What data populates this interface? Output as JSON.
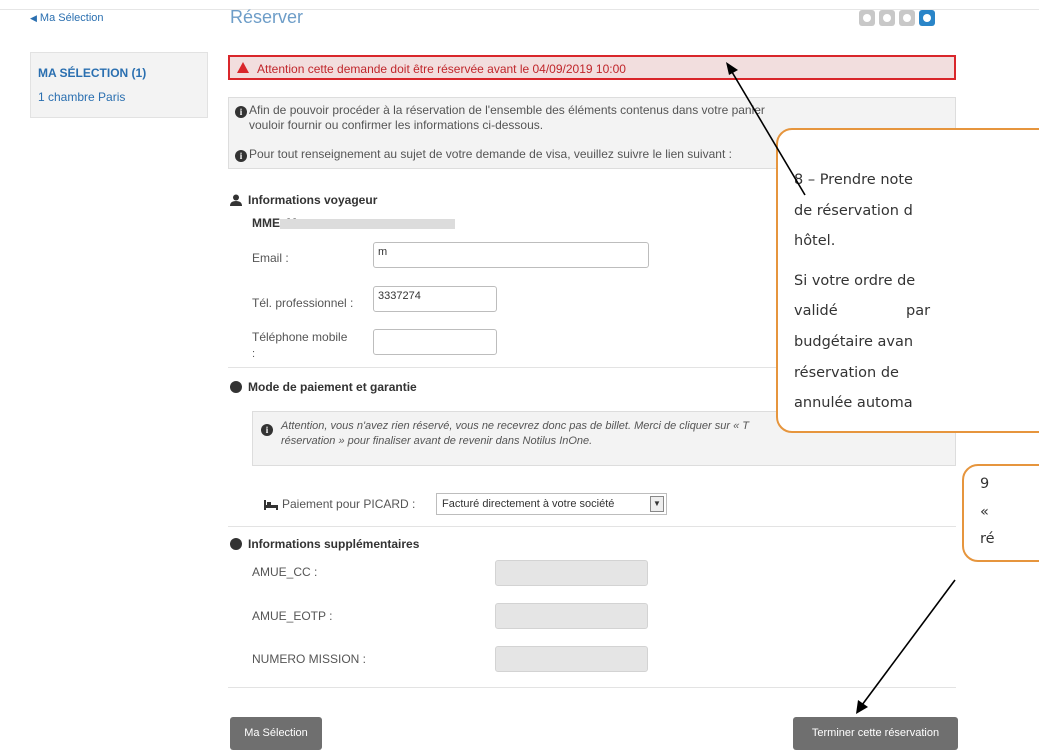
{
  "nav": {
    "back_label": "Ma Sélection"
  },
  "header": {
    "title": "Réserver"
  },
  "steps": {
    "count": 4,
    "active_index": 3
  },
  "sidebar": {
    "title": "MA SÉLECTION (1)",
    "item": "1 chambre Paris"
  },
  "alert": {
    "text": "Attention cette demande doit être réservée avant le 04/09/2019 10:00"
  },
  "info": {
    "line1": "Afin de pouvoir procéder à la réservation de l'ensemble des éléments contenus dans votre panier",
    "line2": "vouloir fournir ou confirmer les informations ci-dessous.",
    "line3": "Pour tout renseignement au sujet de votre demande de visa, veuillez suivre le lien suivant :"
  },
  "traveler": {
    "heading": "Informations voyageur",
    "name": "MME. M",
    "email_label": "Email :",
    "email_value": "m",
    "work_phone_label": "Tél. professionnel :",
    "work_phone_value": "3337274",
    "mobile_label": "Téléphone mobile",
    "mobile_label_suffix": ":",
    "mobile_value": ""
  },
  "payment": {
    "heading": "Mode de paiement et garantie",
    "notice_line1": "Attention, vous n'avez rien réservé, vous ne recevrez donc pas de billet. Merci de cliquer sur « T",
    "notice_line2": "réservation » pour finaliser avant de revenir dans Notilus InOne.",
    "payment_label": "Paiement pour PICARD :",
    "payment_value": "Facturé directement à votre société"
  },
  "extra": {
    "heading": "Informations supplémentaires",
    "field1": "AMUE_CC :",
    "field2": "AMUE_EOTP :",
    "field3": "NUMERO MISSION :"
  },
  "buttons": {
    "back": "Ma Sélection",
    "finish": "Terminer cette réservation"
  },
  "callout_main": {
    "line1": "8 – Prendre note",
    "line2": "de réservation d",
    "line3": "hôtel.",
    "line4": "Si votre ordre de",
    "line5a": "validé",
    "line5b": "par",
    "line6": "budgétaire avan",
    "line7": "réservation de",
    "line8": "annulée automa"
  },
  "callout_small": {
    "line1": "9",
    "line2": "«",
    "line3": "ré"
  },
  "colors": {
    "accent": "#2a6fb0",
    "alert": "#d9262b",
    "callout_border": "#e6953d",
    "button": "#6f6f6f"
  }
}
